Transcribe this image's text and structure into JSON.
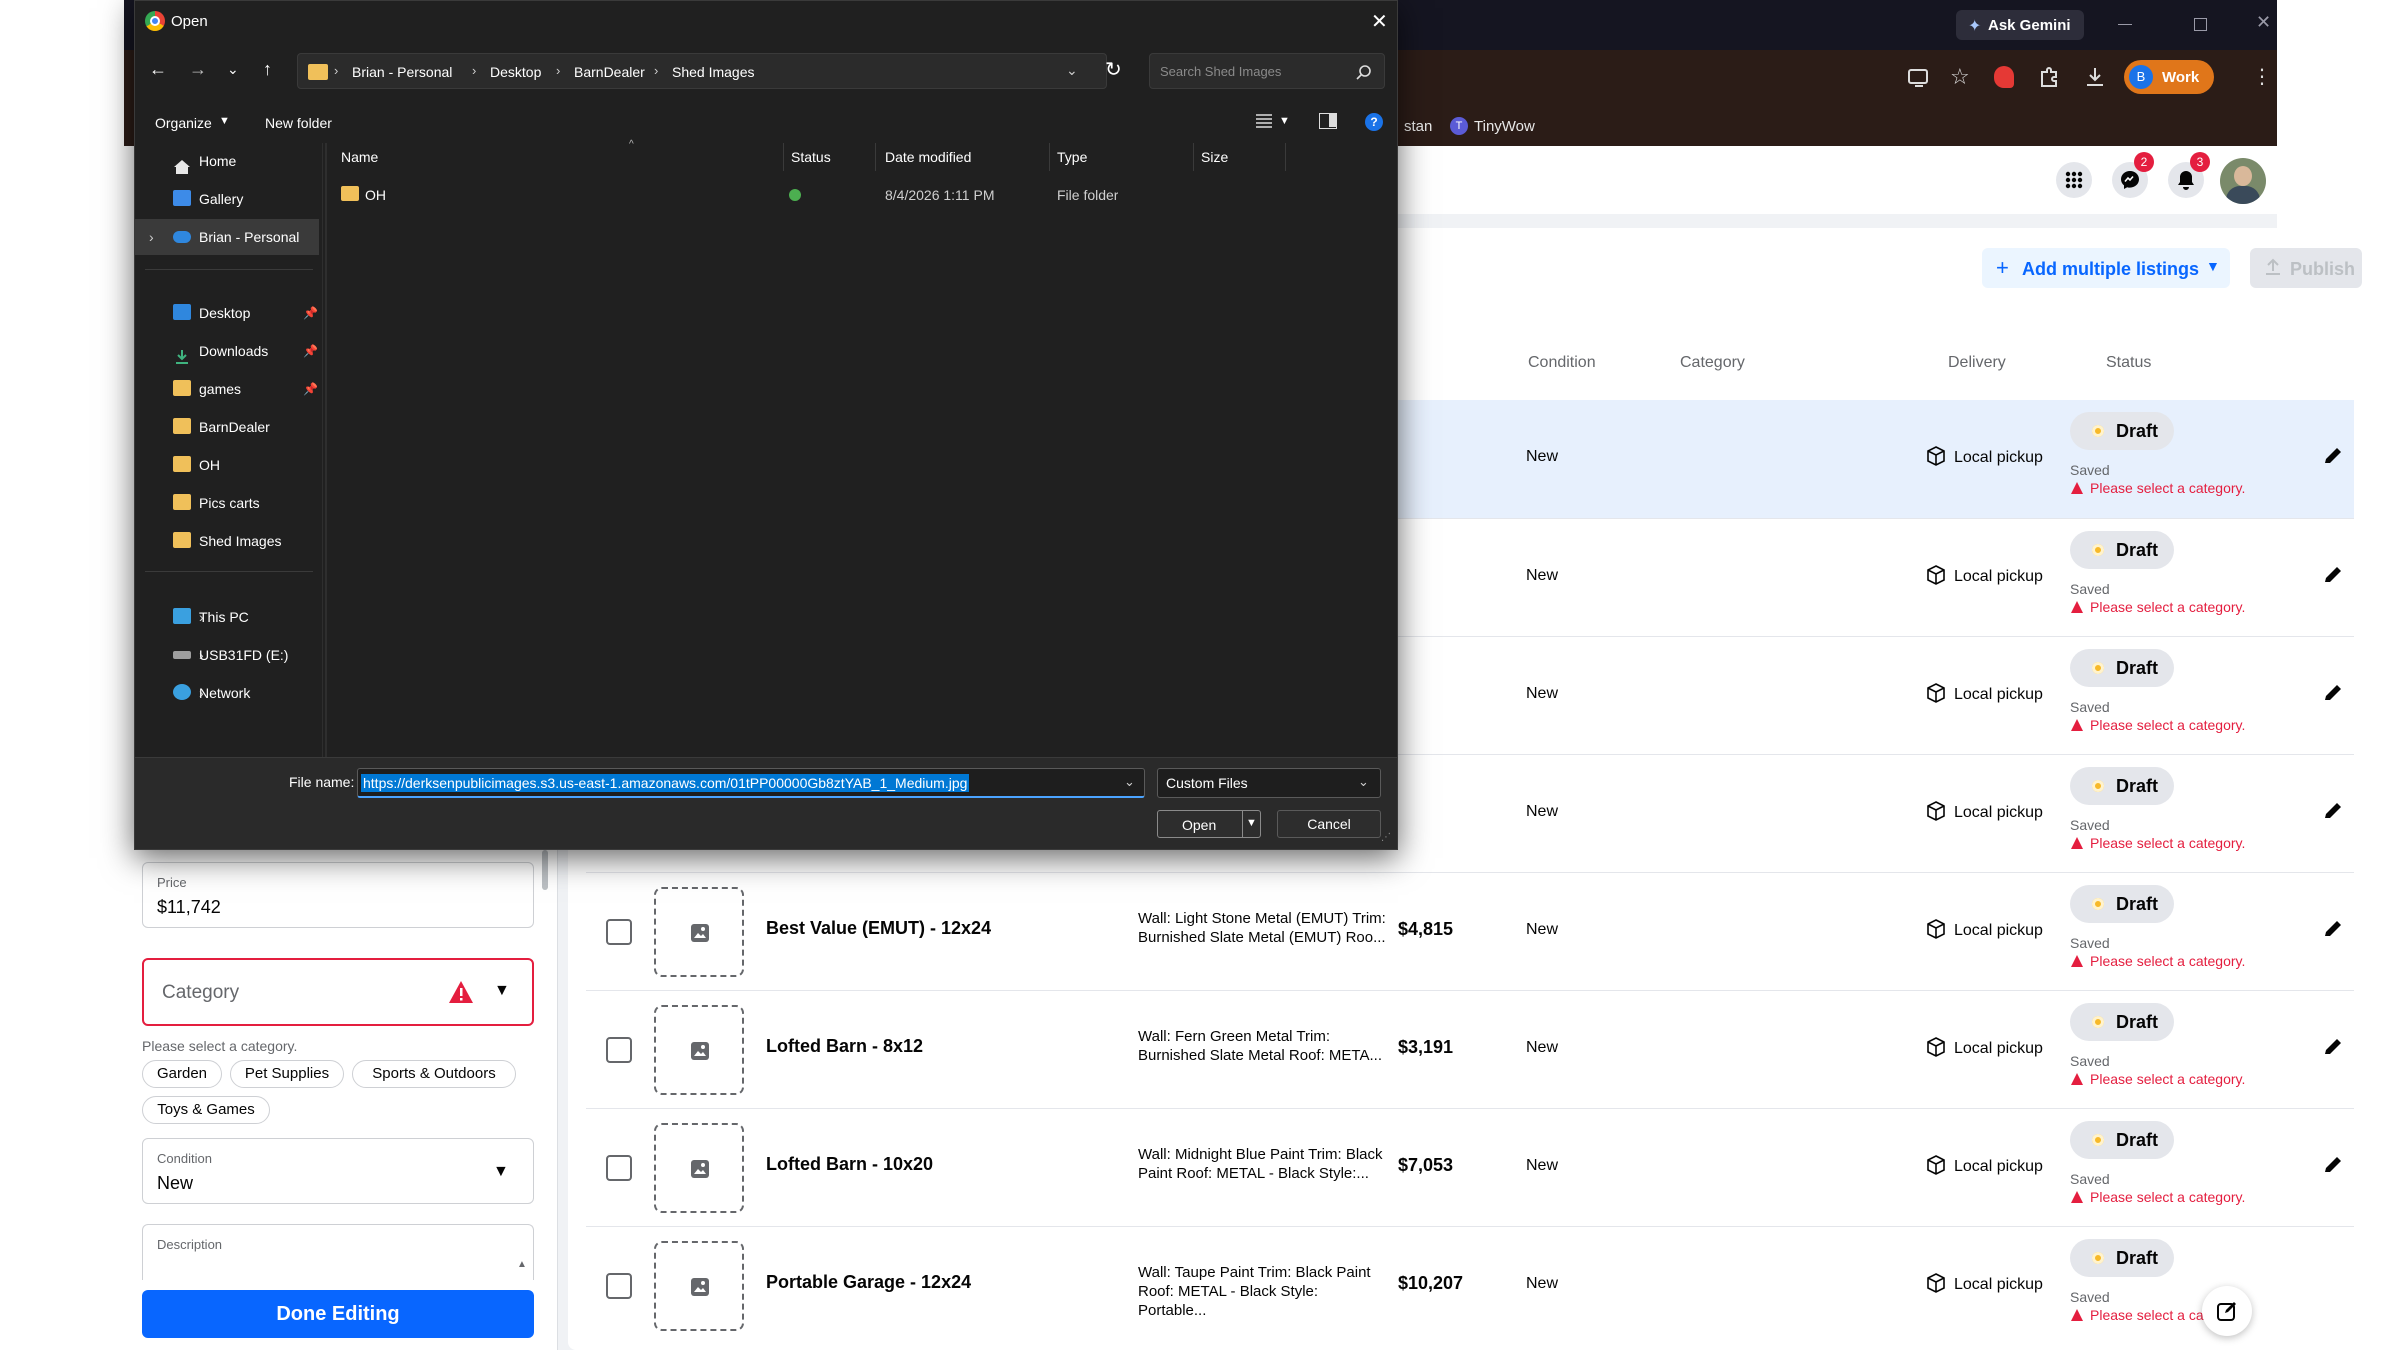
{
  "dialog": {
    "title": "Open",
    "breadcrumb": [
      "Brian - Personal",
      "Desktop",
      "BarnDealer",
      "Shed Images"
    ],
    "search_placeholder": "Search Shed Images",
    "organize_label": "Organize",
    "new_folder_label": "New folder",
    "nav": {
      "home": "Home",
      "gallery": "Gallery",
      "brian_personal": "Brian - Personal",
      "desktop": "Desktop",
      "downloads": "Downloads",
      "games": "games",
      "barndealer": "BarnDealer",
      "oh": "OH",
      "pics_carts": "Pics carts",
      "shed_images": "Shed Images",
      "this_pc": "This PC",
      "usb": "USB31FD (E:)",
      "network": "Network"
    },
    "columns": {
      "name": "Name",
      "status": "Status",
      "date": "Date modified",
      "type": "Type",
      "size": "Size"
    },
    "files": [
      {
        "name": "OH",
        "date": "8/4/2026 1:11 PM",
        "type": "File folder"
      }
    ],
    "file_name_label": "File name:",
    "file_name_value": "https://derksenpublicimages.s3.us-east-1.amazonaws.com/01tPP00000Gb8ztYAB_1_Medium.jpg",
    "file_type": "Custom Files",
    "open_label": "Open",
    "cancel_label": "Cancel"
  },
  "browser": {
    "ask_gemini": "Ask Gemini",
    "profile_label": "Work",
    "profile_initial": "B",
    "bookmark_partial": "stan",
    "bookmark_tinywow": "TinyWow",
    "bookmark_tinywow_initial": "T"
  },
  "fb": {
    "messenger_badge": "2",
    "notif_badge": "3",
    "add_multiple_label": "Add multiple listings",
    "publish_label": "Publish"
  },
  "table": {
    "headers": {
      "condition": "Condition",
      "category": "Category",
      "delivery": "Delivery",
      "status": "Status"
    },
    "rows": [
      {
        "title": "",
        "desc": "",
        "price": "",
        "condition": "New",
        "delivery": "Local pickup",
        "status": "Draft",
        "saved": "Saved",
        "error": "Please select a category."
      },
      {
        "title": "",
        "desc": "",
        "price": "",
        "condition": "New",
        "delivery": "Local pickup",
        "status": "Draft",
        "saved": "Saved",
        "error": "Please select a category."
      },
      {
        "title": "",
        "desc": "",
        "price": "",
        "condition": "New",
        "delivery": "Local pickup",
        "status": "Draft",
        "saved": "Saved",
        "error": "Please select a category."
      },
      {
        "title": "",
        "desc": "",
        "price": "",
        "condition": "New",
        "delivery": "Local pickup",
        "status": "Draft",
        "saved": "Saved",
        "error": "Please select a category."
      },
      {
        "title": "Best Value (EMUT) - 12x24",
        "desc": "Wall: Light Stone Metal (EMUT) Trim: Burnished Slate Metal (EMUT) Roo...",
        "price": "$4,815",
        "condition": "New",
        "delivery": "Local pickup",
        "status": "Draft",
        "saved": "Saved",
        "error": "Please select a category."
      },
      {
        "title": "Lofted Barn - 8x12",
        "desc": "Wall: Fern Green Metal Trim: Burnished Slate Metal Roof: META...",
        "price": "$3,191",
        "condition": "New",
        "delivery": "Local pickup",
        "status": "Draft",
        "saved": "Saved",
        "error": "Please select a category."
      },
      {
        "title": "Lofted Barn - 10x20",
        "desc": "Wall: Midnight Blue Paint Trim: Black Paint Roof: METAL - Black Style:...",
        "price": "$7,053",
        "condition": "New",
        "delivery": "Local pickup",
        "status": "Draft",
        "saved": "Saved",
        "error": "Please select a category."
      },
      {
        "title": "Portable Garage - 12x24",
        "desc": "Wall: Taupe Paint Trim: Black Paint Roof: METAL - Black Style: Portable...",
        "price": "$10,207",
        "condition": "New",
        "delivery": "Local pickup",
        "status": "Draft",
        "saved": "Saved",
        "error": "Please select a category."
      }
    ]
  },
  "editor": {
    "price_label": "Price",
    "price_value": "$11,742",
    "category_placeholder": "Category",
    "category_error": "Please select a category.",
    "suggestions": [
      "Garden",
      "Pet Supplies",
      "Sports & Outdoors",
      "Toys & Games"
    ],
    "condition_label": "Condition",
    "condition_value": "New",
    "description_label": "Description",
    "done_label": "Done Editing"
  },
  "colors": {
    "fb_blue": "#0866ff",
    "error_red": "#e41e3f",
    "draft_dot": "#f7b928",
    "selection_blue": "#0078d4",
    "highlight_row": "#e7f0fd"
  }
}
